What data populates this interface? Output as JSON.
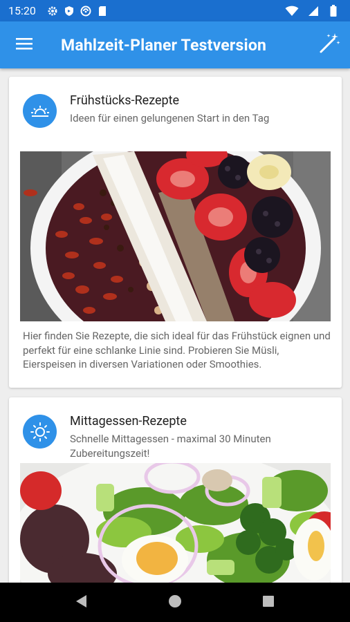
{
  "status_bar": {
    "time": "15:20",
    "left_icons": [
      "settings-icon",
      "shield-icon",
      "vpn-icon",
      "sd-card-icon"
    ],
    "right_icons": [
      "wifi-icon",
      "signal-icon",
      "battery-icon"
    ]
  },
  "app_bar": {
    "title": "Mahlzeit-Planer Testversion",
    "menu_icon": "hamburger-menu-icon",
    "action_icon": "magic-wand-icon"
  },
  "cards": [
    {
      "icon": "sunrise-icon",
      "title": "Frühstücks-Rezepte",
      "subtitle": "Ideen für einen gelungenen Start in den Tag",
      "image": "smoothie bowl with strawberries, blackberries, banana, goji berries, nuts and coconut flakes",
      "description": "Hier finden Sie Rezepte, die sich ideal für das Frühstück eignen und perfekt für eine schlanke Linie sind. Probieren Sie Müsli, Eierspeisen in diversen Variationen oder Smoothies."
    },
    {
      "icon": "sun-icon",
      "title": "Mittagessen-Rezepte",
      "subtitle": "Schnelle Mittagessen - maximal 30 Minuten Zubereitungszeit!",
      "image": "salad with boiled egg, red onion rings, broccoli, celery and tomatoes"
    }
  ],
  "nav_bar": {
    "icons": [
      "back-icon",
      "home-icon",
      "recents-icon"
    ]
  },
  "colors": {
    "status_bar": "#1a6fcf",
    "app_bar": "#2f91e8",
    "accent": "#2f91e8",
    "background": "#eeeeee"
  }
}
